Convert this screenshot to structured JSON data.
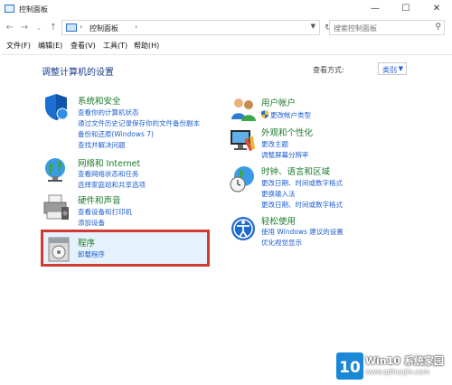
{
  "window": {
    "title": "控制面板"
  },
  "address": {
    "crumb": "控制面板",
    "search_placeholder": "搜索控制面板"
  },
  "menu": [
    "文件(F)",
    "编辑(E)",
    "查看(V)",
    "工具(T)",
    "帮助(H)"
  ],
  "content": {
    "title": "调整计算机的设置",
    "view_by_label": "查看方式:",
    "view_by_value": "类别"
  },
  "left_categories": [
    {
      "title": "系统和安全",
      "links": [
        "查看你的计算机状态",
        "通过文件历史记录保存你的文件备份副本",
        "备份和还原(Windows 7)",
        "查找并解决问题"
      ],
      "icon": "shield-icon"
    },
    {
      "title": "网络和 Internet",
      "links": [
        "查看网络状态和任务",
        "选择家庭组和共享选项"
      ],
      "icon": "network-globe-icon"
    },
    {
      "title": "硬件和声音",
      "links": [
        "查看设备和打印机",
        "添加设备"
      ],
      "icon": "printer-speaker-icon"
    },
    {
      "title": "程序",
      "links": [
        "卸载程序"
      ],
      "icon": "programs-icon"
    }
  ],
  "right_categories": [
    {
      "title": "用户帐户",
      "links": [
        "更改帐户类型"
      ],
      "icon": "users-icon"
    },
    {
      "title": "外观和个性化",
      "links": [
        "更改主题",
        "调整屏幕分辨率"
      ],
      "icon": "display-paint-icon"
    },
    {
      "title": "时钟、语言和区域",
      "links": [
        "更改日期、时间或数字格式",
        "更换输入法",
        "更改日期、时间或数字格式"
      ],
      "icon": "clock-globe-icon"
    },
    {
      "title": "轻松使用",
      "links": [
        "使用 Windows 建议的设置",
        "优化视觉显示"
      ],
      "icon": "ease-of-access-icon"
    }
  ],
  "watermark": {
    "number": "10",
    "brand": "Win10 系统家园",
    "url": "www.qdhuajin.com"
  }
}
